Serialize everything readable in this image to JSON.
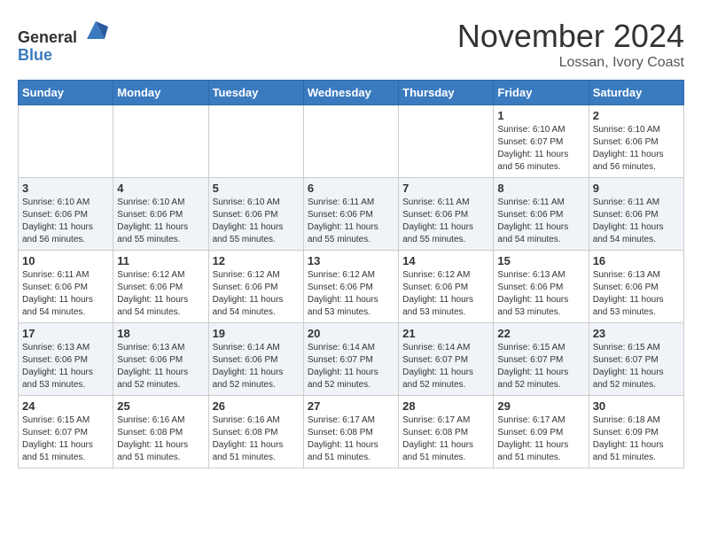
{
  "header": {
    "logo_general": "General",
    "logo_blue": "Blue",
    "month": "November 2024",
    "location": "Lossan, Ivory Coast"
  },
  "weekdays": [
    "Sunday",
    "Monday",
    "Tuesday",
    "Wednesday",
    "Thursday",
    "Friday",
    "Saturday"
  ],
  "weeks": [
    [
      {
        "day": "",
        "info": ""
      },
      {
        "day": "",
        "info": ""
      },
      {
        "day": "",
        "info": ""
      },
      {
        "day": "",
        "info": ""
      },
      {
        "day": "",
        "info": ""
      },
      {
        "day": "1",
        "info": "Sunrise: 6:10 AM\nSunset: 6:07 PM\nDaylight: 11 hours and 56 minutes."
      },
      {
        "day": "2",
        "info": "Sunrise: 6:10 AM\nSunset: 6:06 PM\nDaylight: 11 hours and 56 minutes."
      }
    ],
    [
      {
        "day": "3",
        "info": "Sunrise: 6:10 AM\nSunset: 6:06 PM\nDaylight: 11 hours and 56 minutes."
      },
      {
        "day": "4",
        "info": "Sunrise: 6:10 AM\nSunset: 6:06 PM\nDaylight: 11 hours and 55 minutes."
      },
      {
        "day": "5",
        "info": "Sunrise: 6:10 AM\nSunset: 6:06 PM\nDaylight: 11 hours and 55 minutes."
      },
      {
        "day": "6",
        "info": "Sunrise: 6:11 AM\nSunset: 6:06 PM\nDaylight: 11 hours and 55 minutes."
      },
      {
        "day": "7",
        "info": "Sunrise: 6:11 AM\nSunset: 6:06 PM\nDaylight: 11 hours and 55 minutes."
      },
      {
        "day": "8",
        "info": "Sunrise: 6:11 AM\nSunset: 6:06 PM\nDaylight: 11 hours and 54 minutes."
      },
      {
        "day": "9",
        "info": "Sunrise: 6:11 AM\nSunset: 6:06 PM\nDaylight: 11 hours and 54 minutes."
      }
    ],
    [
      {
        "day": "10",
        "info": "Sunrise: 6:11 AM\nSunset: 6:06 PM\nDaylight: 11 hours and 54 minutes."
      },
      {
        "day": "11",
        "info": "Sunrise: 6:12 AM\nSunset: 6:06 PM\nDaylight: 11 hours and 54 minutes."
      },
      {
        "day": "12",
        "info": "Sunrise: 6:12 AM\nSunset: 6:06 PM\nDaylight: 11 hours and 54 minutes."
      },
      {
        "day": "13",
        "info": "Sunrise: 6:12 AM\nSunset: 6:06 PM\nDaylight: 11 hours and 53 minutes."
      },
      {
        "day": "14",
        "info": "Sunrise: 6:12 AM\nSunset: 6:06 PM\nDaylight: 11 hours and 53 minutes."
      },
      {
        "day": "15",
        "info": "Sunrise: 6:13 AM\nSunset: 6:06 PM\nDaylight: 11 hours and 53 minutes."
      },
      {
        "day": "16",
        "info": "Sunrise: 6:13 AM\nSunset: 6:06 PM\nDaylight: 11 hours and 53 minutes."
      }
    ],
    [
      {
        "day": "17",
        "info": "Sunrise: 6:13 AM\nSunset: 6:06 PM\nDaylight: 11 hours and 53 minutes."
      },
      {
        "day": "18",
        "info": "Sunrise: 6:13 AM\nSunset: 6:06 PM\nDaylight: 11 hours and 52 minutes."
      },
      {
        "day": "19",
        "info": "Sunrise: 6:14 AM\nSunset: 6:06 PM\nDaylight: 11 hours and 52 minutes."
      },
      {
        "day": "20",
        "info": "Sunrise: 6:14 AM\nSunset: 6:07 PM\nDaylight: 11 hours and 52 minutes."
      },
      {
        "day": "21",
        "info": "Sunrise: 6:14 AM\nSunset: 6:07 PM\nDaylight: 11 hours and 52 minutes."
      },
      {
        "day": "22",
        "info": "Sunrise: 6:15 AM\nSunset: 6:07 PM\nDaylight: 11 hours and 52 minutes."
      },
      {
        "day": "23",
        "info": "Sunrise: 6:15 AM\nSunset: 6:07 PM\nDaylight: 11 hours and 52 minutes."
      }
    ],
    [
      {
        "day": "24",
        "info": "Sunrise: 6:15 AM\nSunset: 6:07 PM\nDaylight: 11 hours and 51 minutes."
      },
      {
        "day": "25",
        "info": "Sunrise: 6:16 AM\nSunset: 6:08 PM\nDaylight: 11 hours and 51 minutes."
      },
      {
        "day": "26",
        "info": "Sunrise: 6:16 AM\nSunset: 6:08 PM\nDaylight: 11 hours and 51 minutes."
      },
      {
        "day": "27",
        "info": "Sunrise: 6:17 AM\nSunset: 6:08 PM\nDaylight: 11 hours and 51 minutes."
      },
      {
        "day": "28",
        "info": "Sunrise: 6:17 AM\nSunset: 6:08 PM\nDaylight: 11 hours and 51 minutes."
      },
      {
        "day": "29",
        "info": "Sunrise: 6:17 AM\nSunset: 6:09 PM\nDaylight: 11 hours and 51 minutes."
      },
      {
        "day": "30",
        "info": "Sunrise: 6:18 AM\nSunset: 6:09 PM\nDaylight: 11 hours and 51 minutes."
      }
    ]
  ]
}
